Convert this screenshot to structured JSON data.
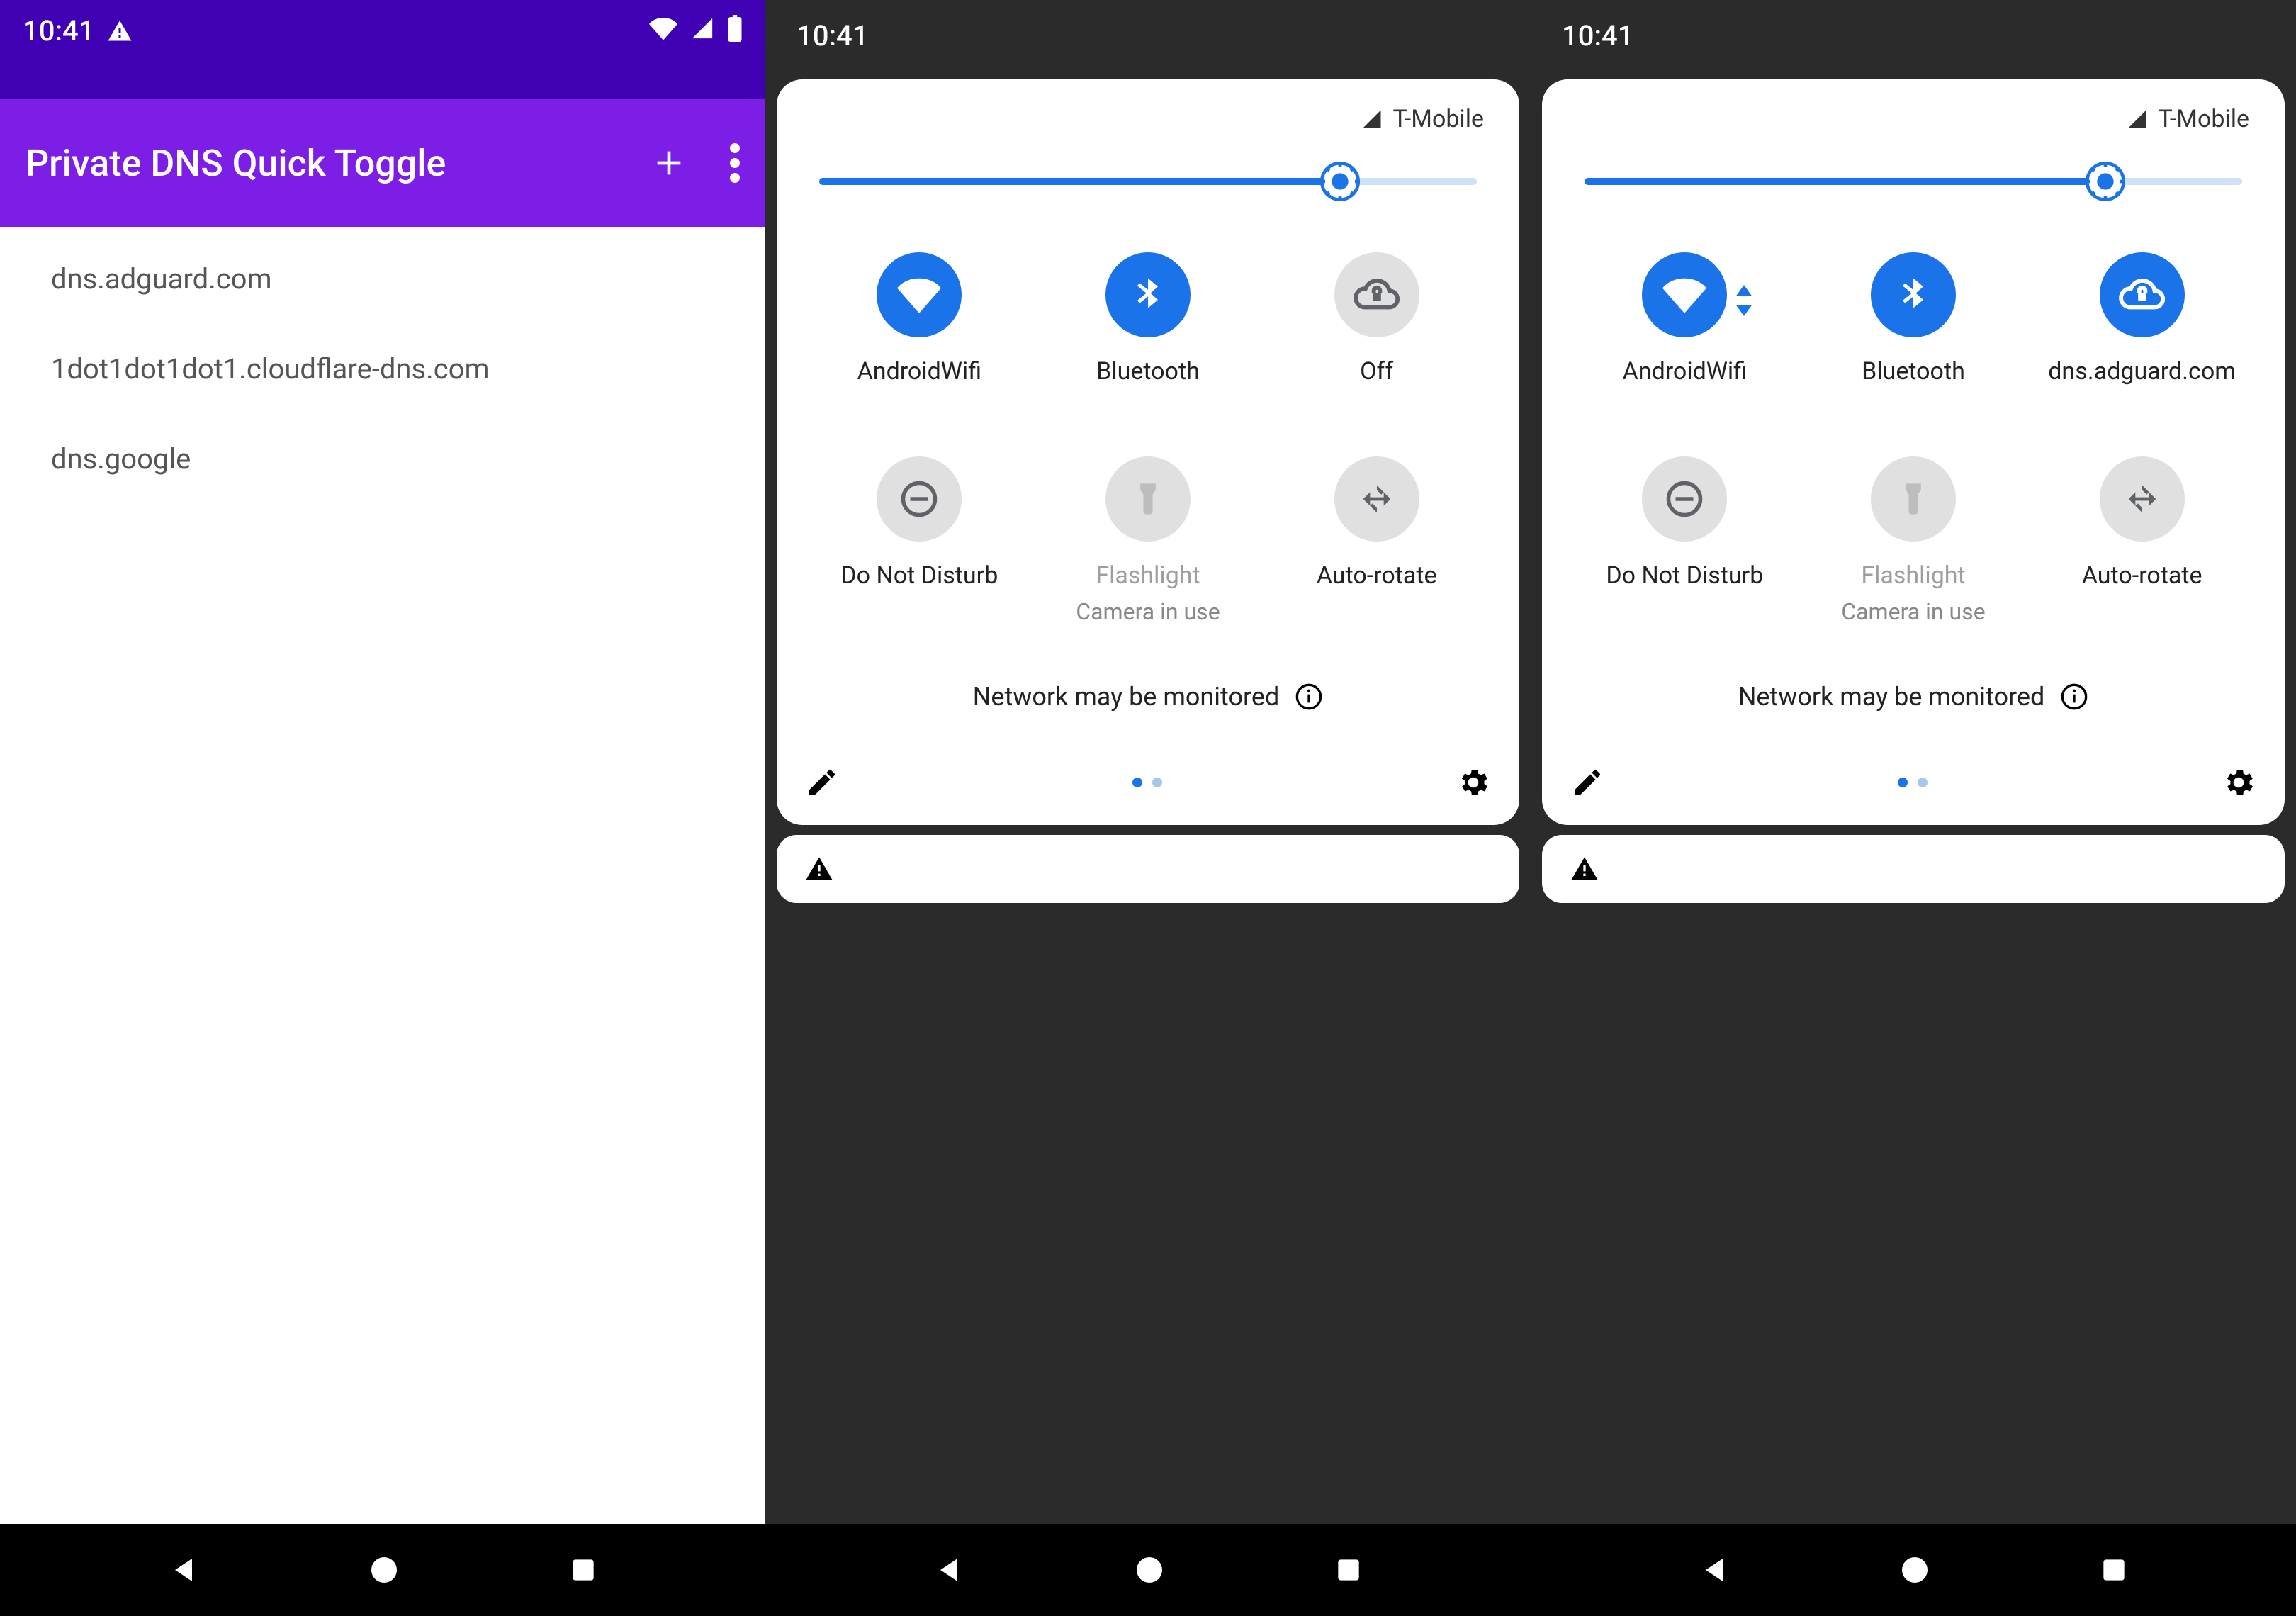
{
  "status": {
    "time": "10:41"
  },
  "app": {
    "title": "Private DNS Quick Toggle",
    "items": [
      "dns.adguard.com",
      "1dot1dot1dot1.cloudflare-dns.com",
      "dns.google"
    ]
  },
  "carrier": "T-Mobile",
  "brightness_pct": 78,
  "monitor_msg": "Network may be monitored",
  "tiles_off": {
    "wifi": {
      "label": "AndroidWifi",
      "active": true
    },
    "bt": {
      "label": "Bluetooth",
      "active": true
    },
    "dns": {
      "label": "Off",
      "active": false
    },
    "dnd": {
      "label": "Do Not Disturb",
      "active": false
    },
    "flash": {
      "label": "Flashlight",
      "sub": "Camera in use",
      "active": false,
      "dim": true
    },
    "rotate": {
      "label": "Auto-rotate",
      "active": false
    }
  },
  "tiles_on": {
    "wifi": {
      "label": "AndroidWifi",
      "active": true,
      "arrows": true
    },
    "bt": {
      "label": "Bluetooth",
      "active": true
    },
    "dns": {
      "label": "dns.adguard.com",
      "active": true
    },
    "dnd": {
      "label": "Do Not Disturb",
      "active": false
    },
    "flash": {
      "label": "Flashlight",
      "sub": "Camera in use",
      "active": false,
      "dim": true
    },
    "rotate": {
      "label": "Auto-rotate",
      "active": false
    }
  }
}
